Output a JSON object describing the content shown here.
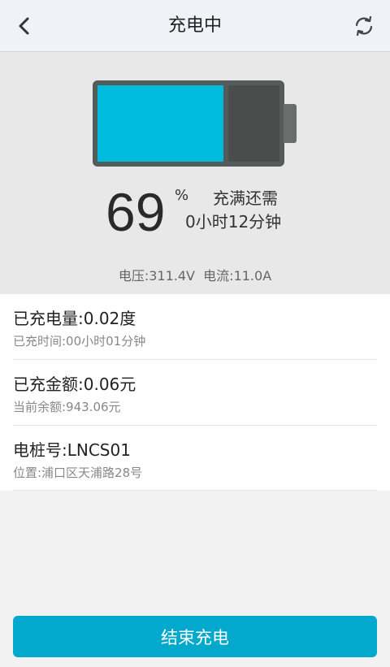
{
  "header": {
    "title": "充电中",
    "back_icon": "chevron-left-icon",
    "refresh_icon": "refresh-icon"
  },
  "battery": {
    "level_percent": 69,
    "percent_text": "69",
    "percent_unit": "%",
    "remain_label": "充满还需",
    "remain_time": "0小时12分钟",
    "voltage_current": "电压:311.4V  电流:11.0A",
    "fill_color": "#00bcdc",
    "empty_color": "#4a4d4b"
  },
  "info": [
    {
      "title": "已充电量:0.02度",
      "sub": "已充时间:00小时01分钟"
    },
    {
      "title": "已充金额:0.06元",
      "sub": "当前余额:943.06元"
    },
    {
      "title": "电桩号:LNCS01",
      "sub": "位置:浦口区天浦路28号"
    }
  ],
  "actions": {
    "end_label": "结束充电",
    "accent": "#03a9cc"
  }
}
